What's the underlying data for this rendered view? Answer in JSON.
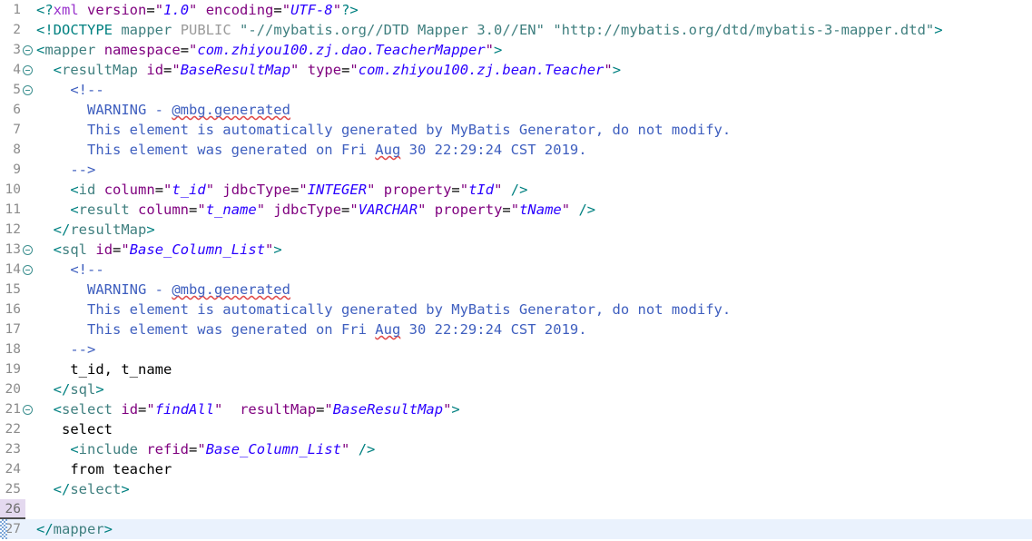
{
  "editor": {
    "kind": "xml-source-editor",
    "file_kind": "MyBatis XML Mapper",
    "cursor_line": 26,
    "highlighted_line": 27,
    "total_lines": 27,
    "colors": {
      "background": "#ffffff",
      "gutter_text": "#8c8c8c",
      "tag": "#3f7f7f",
      "attribute": "#7f007f",
      "value": "#2a00ff",
      "comment": "#3f5fbf",
      "text": "#000000",
      "current_line_highlight": "#eaf2fd",
      "cursor_gutter_highlight": "#e4d9ef",
      "fold_marker": "#3c8f8f",
      "spellcheck_squiggle": "#e04b4b"
    }
  },
  "lines": [
    {
      "n": "1",
      "fold": false,
      "tokens": [
        {
          "c": "t-bracket",
          "t": "<?"
        },
        {
          "c": "t-proc",
          "t": "xml"
        },
        {
          "c": "t-plain",
          "t": " "
        },
        {
          "c": "t-attr",
          "t": "version"
        },
        {
          "c": "t-eq",
          "t": "="
        },
        {
          "c": "t-quote",
          "t": "\""
        },
        {
          "c": "t-val",
          "t": "1.0"
        },
        {
          "c": "t-quote",
          "t": "\""
        },
        {
          "c": "t-plain",
          "t": " "
        },
        {
          "c": "t-attr",
          "t": "encoding"
        },
        {
          "c": "t-eq",
          "t": "="
        },
        {
          "c": "t-quote",
          "t": "\""
        },
        {
          "c": "t-val",
          "t": "UTF-8"
        },
        {
          "c": "t-quote",
          "t": "\""
        },
        {
          "c": "t-bracket",
          "t": "?>"
        }
      ]
    },
    {
      "n": "2",
      "fold": false,
      "tokens": [
        {
          "c": "t-bracket",
          "t": "<!DOCTYPE"
        },
        {
          "c": "t-plain",
          "t": " "
        },
        {
          "c": "t-tag",
          "t": "mapper"
        },
        {
          "c": "t-plain",
          "t": " "
        },
        {
          "c": "t-doctype-kw",
          "t": "PUBLIC"
        },
        {
          "c": "t-plain",
          "t": " "
        },
        {
          "c": "t-str",
          "t": "\"-//mybatis.org//DTD Mapper 3.0//EN\""
        },
        {
          "c": "t-plain",
          "t": " "
        },
        {
          "c": "t-str",
          "t": "\"http://mybatis.org/dtd/mybatis-3-mapper.dtd\""
        },
        {
          "c": "t-bracket",
          "t": ">"
        }
      ]
    },
    {
      "n": "3",
      "fold": true,
      "tokens": [
        {
          "c": "t-bracket",
          "t": "<"
        },
        {
          "c": "t-tag",
          "t": "mapper"
        },
        {
          "c": "t-plain",
          "t": " "
        },
        {
          "c": "t-attr",
          "t": "namespace"
        },
        {
          "c": "t-eq",
          "t": "="
        },
        {
          "c": "t-quote",
          "t": "\""
        },
        {
          "c": "t-val",
          "t": "com.zhiyou100.zj.dao.TeacherMapper"
        },
        {
          "c": "t-quote",
          "t": "\""
        },
        {
          "c": "t-bracket",
          "t": ">"
        }
      ]
    },
    {
      "n": "4",
      "fold": true,
      "tokens": [
        {
          "c": "t-plain",
          "t": "  "
        },
        {
          "c": "t-bracket",
          "t": "<"
        },
        {
          "c": "t-tag",
          "t": "resultMap"
        },
        {
          "c": "t-plain",
          "t": " "
        },
        {
          "c": "t-attr",
          "t": "id"
        },
        {
          "c": "t-eq",
          "t": "="
        },
        {
          "c": "t-quote",
          "t": "\""
        },
        {
          "c": "t-val",
          "t": "BaseResultMap"
        },
        {
          "c": "t-quote",
          "t": "\""
        },
        {
          "c": "t-plain",
          "t": " "
        },
        {
          "c": "t-attr",
          "t": "type"
        },
        {
          "c": "t-eq",
          "t": "="
        },
        {
          "c": "t-quote",
          "t": "\""
        },
        {
          "c": "t-val",
          "t": "com.zhiyou100.zj.bean.Teacher"
        },
        {
          "c": "t-quote",
          "t": "\""
        },
        {
          "c": "t-bracket",
          "t": ">"
        }
      ]
    },
    {
      "n": "5",
      "fold": true,
      "tokens": [
        {
          "c": "t-comment",
          "t": "    <!--"
        }
      ]
    },
    {
      "n": "6",
      "fold": false,
      "tokens": [
        {
          "c": "t-comment",
          "t": "      WARNING - "
        },
        {
          "c": "t-comment spell",
          "t": "@mbg.generated"
        }
      ]
    },
    {
      "n": "7",
      "fold": false,
      "tokens": [
        {
          "c": "t-comment",
          "t": "      This element is automatically generated by MyBatis Generator, do not modify."
        }
      ]
    },
    {
      "n": "8",
      "fold": false,
      "tokens": [
        {
          "c": "t-comment",
          "t": "      This element was generated on Fri "
        },
        {
          "c": "t-comment spell",
          "t": "Aug"
        },
        {
          "c": "t-comment",
          "t": " 30 22:29:24 CST 2019."
        }
      ]
    },
    {
      "n": "9",
      "fold": false,
      "tokens": [
        {
          "c": "t-comment",
          "t": "    -->"
        }
      ]
    },
    {
      "n": "10",
      "fold": false,
      "tokens": [
        {
          "c": "t-plain",
          "t": "    "
        },
        {
          "c": "t-bracket",
          "t": "<"
        },
        {
          "c": "t-tag",
          "t": "id"
        },
        {
          "c": "t-plain",
          "t": " "
        },
        {
          "c": "t-attr",
          "t": "column"
        },
        {
          "c": "t-eq",
          "t": "="
        },
        {
          "c": "t-quote",
          "t": "\""
        },
        {
          "c": "t-val",
          "t": "t_id"
        },
        {
          "c": "t-quote",
          "t": "\""
        },
        {
          "c": "t-plain",
          "t": " "
        },
        {
          "c": "t-attr",
          "t": "jdbcType"
        },
        {
          "c": "t-eq",
          "t": "="
        },
        {
          "c": "t-quote",
          "t": "\""
        },
        {
          "c": "t-val",
          "t": "INTEGER"
        },
        {
          "c": "t-quote",
          "t": "\""
        },
        {
          "c": "t-plain",
          "t": " "
        },
        {
          "c": "t-attr",
          "t": "property"
        },
        {
          "c": "t-eq",
          "t": "="
        },
        {
          "c": "t-quote",
          "t": "\""
        },
        {
          "c": "t-val",
          "t": "tId"
        },
        {
          "c": "t-quote",
          "t": "\""
        },
        {
          "c": "t-plain",
          "t": " "
        },
        {
          "c": "t-bracket",
          "t": "/>"
        }
      ]
    },
    {
      "n": "11",
      "fold": false,
      "tokens": [
        {
          "c": "t-plain",
          "t": "    "
        },
        {
          "c": "t-bracket",
          "t": "<"
        },
        {
          "c": "t-tag",
          "t": "result"
        },
        {
          "c": "t-plain",
          "t": " "
        },
        {
          "c": "t-attr",
          "t": "column"
        },
        {
          "c": "t-eq",
          "t": "="
        },
        {
          "c": "t-quote",
          "t": "\""
        },
        {
          "c": "t-val",
          "t": "t_name"
        },
        {
          "c": "t-quote",
          "t": "\""
        },
        {
          "c": "t-plain",
          "t": " "
        },
        {
          "c": "t-attr",
          "t": "jdbcType"
        },
        {
          "c": "t-eq",
          "t": "="
        },
        {
          "c": "t-quote",
          "t": "\""
        },
        {
          "c": "t-val",
          "t": "VARCHAR"
        },
        {
          "c": "t-quote",
          "t": "\""
        },
        {
          "c": "t-plain",
          "t": " "
        },
        {
          "c": "t-attr",
          "t": "property"
        },
        {
          "c": "t-eq",
          "t": "="
        },
        {
          "c": "t-quote",
          "t": "\""
        },
        {
          "c": "t-val",
          "t": "tName"
        },
        {
          "c": "t-quote",
          "t": "\""
        },
        {
          "c": "t-plain",
          "t": " "
        },
        {
          "c": "t-bracket",
          "t": "/>"
        }
      ]
    },
    {
      "n": "12",
      "fold": false,
      "tokens": [
        {
          "c": "t-plain",
          "t": "  "
        },
        {
          "c": "t-bracket",
          "t": "</"
        },
        {
          "c": "t-tag",
          "t": "resultMap"
        },
        {
          "c": "t-bracket",
          "t": ">"
        }
      ]
    },
    {
      "n": "13",
      "fold": true,
      "tokens": [
        {
          "c": "t-plain",
          "t": "  "
        },
        {
          "c": "t-bracket",
          "t": "<"
        },
        {
          "c": "t-tag",
          "t": "sql"
        },
        {
          "c": "t-plain",
          "t": " "
        },
        {
          "c": "t-attr",
          "t": "id"
        },
        {
          "c": "t-eq",
          "t": "="
        },
        {
          "c": "t-quote",
          "t": "\""
        },
        {
          "c": "t-val",
          "t": "Base_Column_List"
        },
        {
          "c": "t-quote",
          "t": "\""
        },
        {
          "c": "t-bracket",
          "t": ">"
        }
      ]
    },
    {
      "n": "14",
      "fold": true,
      "tokens": [
        {
          "c": "t-comment",
          "t": "    <!--"
        }
      ]
    },
    {
      "n": "15",
      "fold": false,
      "tokens": [
        {
          "c": "t-comment",
          "t": "      WARNING - "
        },
        {
          "c": "t-comment spell",
          "t": "@mbg.generated"
        }
      ]
    },
    {
      "n": "16",
      "fold": false,
      "tokens": [
        {
          "c": "t-comment",
          "t": "      This element is automatically generated by MyBatis Generator, do not modify."
        }
      ]
    },
    {
      "n": "17",
      "fold": false,
      "tokens": [
        {
          "c": "t-comment",
          "t": "      This element was generated on Fri "
        },
        {
          "c": "t-comment spell",
          "t": "Aug"
        },
        {
          "c": "t-comment",
          "t": " 30 22:29:24 CST 2019."
        }
      ]
    },
    {
      "n": "18",
      "fold": false,
      "tokens": [
        {
          "c": "t-comment",
          "t": "    -->"
        }
      ]
    },
    {
      "n": "19",
      "fold": false,
      "tokens": [
        {
          "c": "t-text",
          "t": "    t_id, t_name"
        }
      ]
    },
    {
      "n": "20",
      "fold": false,
      "tokens": [
        {
          "c": "t-plain",
          "t": "  "
        },
        {
          "c": "t-bracket",
          "t": "</"
        },
        {
          "c": "t-tag",
          "t": "sql"
        },
        {
          "c": "t-bracket",
          "t": ">"
        }
      ]
    },
    {
      "n": "21",
      "fold": true,
      "tokens": [
        {
          "c": "t-plain",
          "t": "  "
        },
        {
          "c": "t-bracket",
          "t": "<"
        },
        {
          "c": "t-tag",
          "t": "select"
        },
        {
          "c": "t-plain",
          "t": " "
        },
        {
          "c": "t-attr",
          "t": "id"
        },
        {
          "c": "t-eq",
          "t": "="
        },
        {
          "c": "t-quote",
          "t": "\""
        },
        {
          "c": "t-val",
          "t": "findAll"
        },
        {
          "c": "t-quote",
          "t": "\""
        },
        {
          "c": "t-plain",
          "t": "  "
        },
        {
          "c": "t-attr",
          "t": "resultMap"
        },
        {
          "c": "t-eq",
          "t": "="
        },
        {
          "c": "t-quote",
          "t": "\""
        },
        {
          "c": "t-val",
          "t": "BaseResultMap"
        },
        {
          "c": "t-quote",
          "t": "\""
        },
        {
          "c": "t-bracket",
          "t": ">"
        }
      ]
    },
    {
      "n": "22",
      "fold": false,
      "tokens": [
        {
          "c": "t-text",
          "t": "   select"
        }
      ]
    },
    {
      "n": "23",
      "fold": false,
      "tokens": [
        {
          "c": "t-plain",
          "t": "    "
        },
        {
          "c": "t-bracket",
          "t": "<"
        },
        {
          "c": "t-tag",
          "t": "include"
        },
        {
          "c": "t-plain",
          "t": " "
        },
        {
          "c": "t-attr",
          "t": "refid"
        },
        {
          "c": "t-eq",
          "t": "="
        },
        {
          "c": "t-quote",
          "t": "\""
        },
        {
          "c": "t-val",
          "t": "Base_Column_List"
        },
        {
          "c": "t-quote",
          "t": "\""
        },
        {
          "c": "t-plain",
          "t": " "
        },
        {
          "c": "t-bracket",
          "t": "/>"
        }
      ]
    },
    {
      "n": "24",
      "fold": false,
      "tokens": [
        {
          "c": "t-text",
          "t": "    from teacher"
        }
      ]
    },
    {
      "n": "25",
      "fold": false,
      "tokens": [
        {
          "c": "t-plain",
          "t": "  "
        },
        {
          "c": "t-bracket",
          "t": "</"
        },
        {
          "c": "t-tag",
          "t": "select"
        },
        {
          "c": "t-bracket",
          "t": ">"
        }
      ]
    },
    {
      "n": "26",
      "fold": false,
      "cursor": true,
      "tokens": []
    },
    {
      "n": "27",
      "fold": false,
      "marked": true,
      "highlight": true,
      "tokens": [
        {
          "c": "t-bracket",
          "t": "</"
        },
        {
          "c": "t-tag",
          "t": "mapper"
        },
        {
          "c": "t-bracket",
          "t": ">"
        }
      ]
    }
  ]
}
